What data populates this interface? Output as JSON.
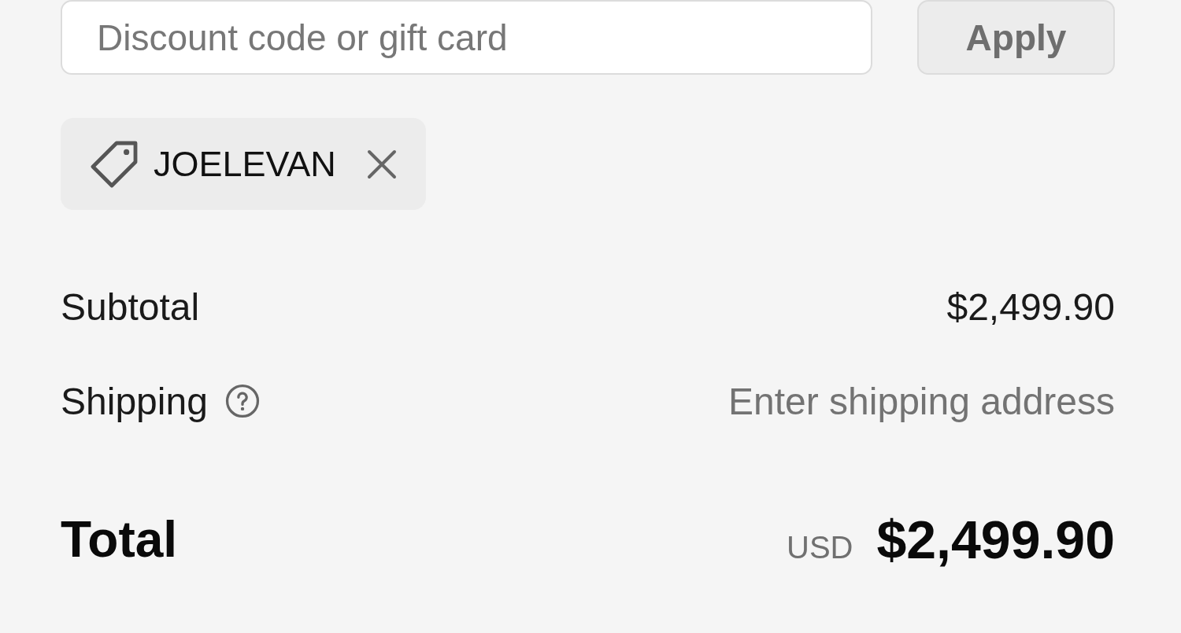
{
  "discount": {
    "placeholder": "Discount code or gift card",
    "apply_button": {
      "label": "Apply",
      "disabled": true
    }
  },
  "applied_codes": [
    {
      "code": "JOELEVAN"
    }
  ],
  "summary_rows": [
    {
      "label": "Subtotal",
      "help_icon": false,
      "kind": "amount",
      "value": "$2,499.90"
    },
    {
      "label": "Shipping",
      "help_icon": true,
      "kind": "note",
      "value": "Enter shipping address"
    }
  ],
  "total": {
    "label": "Total",
    "currency": "USD",
    "amount": "$2,499.90"
  }
}
